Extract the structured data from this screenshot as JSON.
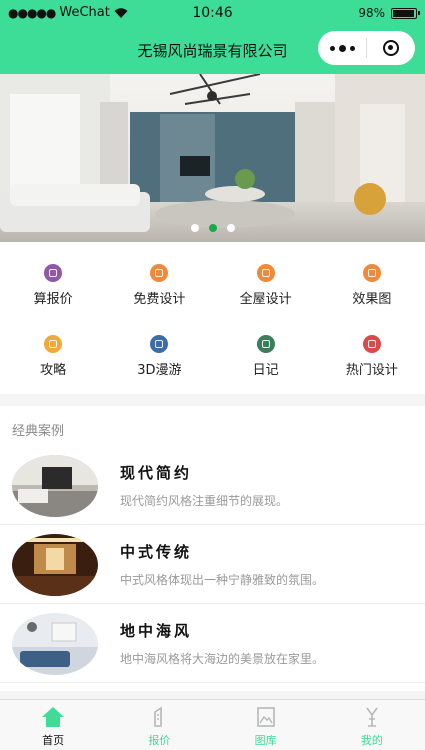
{
  "status": {
    "carrier": "WeChat",
    "time": "10:46",
    "battery": "98%",
    "battery_level": 0.98
  },
  "nav": {
    "title": "无锡风尚瑞景有限公司",
    "more_icon": "more-dots-icon",
    "close_icon": "mini-program-close-icon"
  },
  "banner": {
    "slide_count": 3,
    "active_index": 1,
    "active_color": "#1aa84c"
  },
  "categories": [
    {
      "label": "算报价",
      "icon": "calculator-icon",
      "color": "#8e5aa8"
    },
    {
      "label": "免费设计",
      "icon": "design-icon",
      "color": "#f08a3a"
    },
    {
      "label": "全屋设计",
      "icon": "house-icon",
      "color": "#f08a3a"
    },
    {
      "label": "效果图",
      "icon": "image-icon",
      "color": "#f08a3a"
    },
    {
      "label": "攻略",
      "icon": "guide-icon",
      "color": "#f2a93b"
    },
    {
      "label": "3D漫游",
      "icon": "vr-icon",
      "color": "#3b6ea8"
    },
    {
      "label": "日记",
      "icon": "diary-icon",
      "color": "#3c7d5e"
    },
    {
      "label": "热门设计",
      "icon": "hot-icon",
      "color": "#d94a4a"
    }
  ],
  "cases_section": {
    "title": "经典案例",
    "items": [
      {
        "title": "现代简约",
        "desc": "现代简约风格注重细节的展现。"
      },
      {
        "title": "中式传统",
        "desc": "中式风格体现出一种宁静雅致的氛围。"
      },
      {
        "title": "地中海风",
        "desc": "地中海风格将大海边的美景放在家里。"
      }
    ]
  },
  "tabbar": {
    "active_color": "#3ddc97",
    "tabs": [
      {
        "label": "首页",
        "icon": "home-icon",
        "active": true
      },
      {
        "label": "报价",
        "icon": "quote-icon",
        "active": false
      },
      {
        "label": "图库",
        "icon": "gallery-icon",
        "active": false
      },
      {
        "label": "我的",
        "icon": "profile-icon",
        "active": false
      }
    ]
  }
}
